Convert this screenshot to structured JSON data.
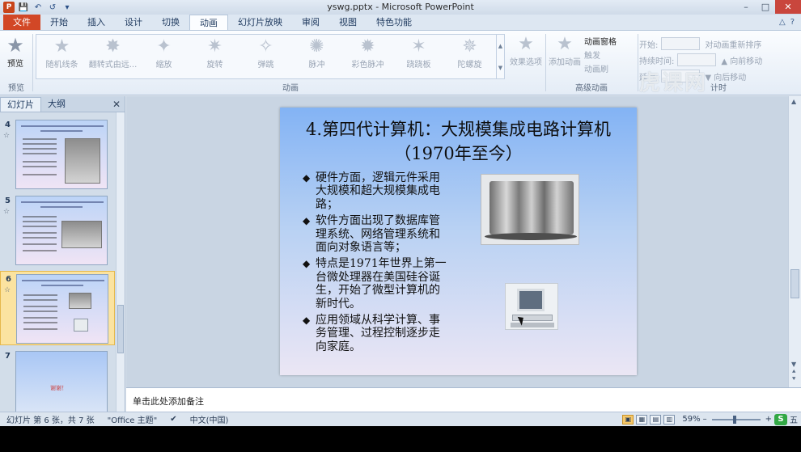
{
  "window": {
    "title": "yswg.pptx - Microsoft PowerPoint"
  },
  "qat": {
    "logo": "P",
    "save": "💾",
    "undo": "↶",
    "redo": "↺",
    "more": "▾"
  },
  "window_controls": {
    "minimize": "–",
    "maximize": "□",
    "close": "✕"
  },
  "tabs": [
    "文件",
    "开始",
    "插入",
    "设计",
    "切换",
    "动画",
    "幻灯片放映",
    "审阅",
    "视图",
    "特色功能"
  ],
  "tabs_right": {
    "minimize_ribbon": "△",
    "help": "?"
  },
  "ribbon": {
    "preview_label": "预览",
    "preview_group": "预览",
    "animations": [
      "随机线条",
      "翻转式由远...",
      "缩放",
      "旋转",
      "弹跳",
      "脉冲",
      "彩色脉冲",
      "跷跷板",
      "陀螺旋"
    ],
    "effect_options": "效果选项",
    "animation_group": "动画",
    "add_animation": "添加动画",
    "advanced": [
      "动画窗格",
      "触发",
      "动画刷"
    ],
    "advanced_group": "高级动画",
    "timing": {
      "start": "开始:",
      "duration": "持续时间:",
      "delay": "延迟:",
      "reorder": "对动画重新排序",
      "move_earlier": "▲ 向前移动",
      "move_later": "▼ 向后移动"
    },
    "timing_group": "计时"
  },
  "left_pane": {
    "tabs": [
      "幻灯片",
      "大纲"
    ],
    "close": "✕",
    "thumbs": [
      {
        "num": "4",
        "anim": "☆"
      },
      {
        "num": "5",
        "anim": "☆"
      },
      {
        "num": "6",
        "anim": "☆"
      },
      {
        "num": "7",
        "anim": "",
        "text": "谢谢！"
      }
    ]
  },
  "slide": {
    "title": "4.第四代计算机：大规模集成电路计算机（1970年至今）",
    "bullets": [
      "硬件方面，逻辑元件采用大规模和超大规模集成电路；",
      "软件方面出现了数据库管理系统、网络管理系统和面向对象语言等；",
      "特点是1971年世界上第一台微处理器在美国硅谷诞生，开始了微型计算机的新时代。",
      "应用领域从科学计算、事务管理、过程控制逐步走向家庭。"
    ],
    "bullet_marker": "◆"
  },
  "scroll": {
    "up": "▲",
    "down": "▼",
    "page_up": "⯅",
    "page_down": "⯆"
  },
  "notes": {
    "placeholder": "单击此处添加备注"
  },
  "status": {
    "slide_info": "幻灯片 第 6 张，共 7 张",
    "theme": "\"Office 主题\"",
    "language": "中文(中国)",
    "zoom": "59%",
    "zoom_minus": "–",
    "zoom_plus": "+",
    "ime": "S",
    "ime_mode": "五",
    "view_icons": [
      "▣",
      "▦",
      "▤",
      "▥"
    ]
  },
  "watermark": "虎课网"
}
